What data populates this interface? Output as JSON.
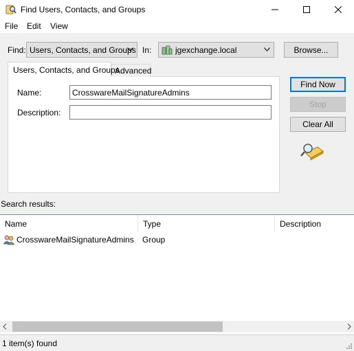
{
  "window": {
    "title": "Find Users, Contacts, and Groups",
    "icon": "find-directory-icon"
  },
  "menu": {
    "file": "File",
    "edit": "Edit",
    "view": "View"
  },
  "find": {
    "find_label": "Find:",
    "find_value": "Users, Contacts, and Groups",
    "in_label": "In:",
    "in_value": "jgexchange.local",
    "browse_label": "Browse..."
  },
  "tabs": {
    "active": "Users, Contacts, and Groups",
    "advanced": "Advanced"
  },
  "form": {
    "name_label": "Name:",
    "name_value": "CrosswareMailSignatureAdmins",
    "description_label": "Description:",
    "description_value": ""
  },
  "buttons": {
    "find_now": "Find Now",
    "stop": "Stop",
    "clear_all": "Clear All"
  },
  "results": {
    "label": "Search results:",
    "columns": [
      "Name",
      "Type",
      "Description"
    ],
    "rows": [
      {
        "name": "CrosswareMailSignatureAdmins",
        "type": "Group",
        "description": ""
      }
    ]
  },
  "status": {
    "text": "1 item(s) found"
  },
  "colors": {
    "accent": "#0078d7",
    "panel": "#f0f0f0"
  }
}
